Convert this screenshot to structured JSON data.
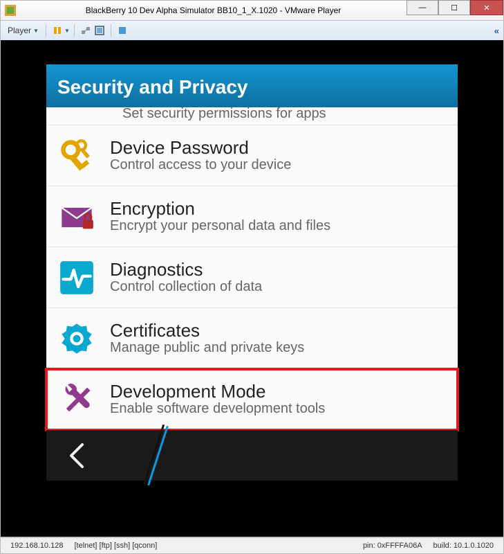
{
  "window": {
    "title": "BlackBerry 10 Dev Alpha Simulator BB10_1_X.1020 - VMware Player",
    "player_label": "Player"
  },
  "bb_header": {
    "title": "Security and Privacy"
  },
  "partial_item_subtitle": "Set security permissions for apps",
  "items": [
    {
      "title": "Device Password",
      "subtitle": "Control access to your device",
      "icon": "key-icon"
    },
    {
      "title": "Encryption",
      "subtitle": "Encrypt your personal data and files",
      "icon": "envelope-lock-icon"
    },
    {
      "title": "Diagnostics",
      "subtitle": "Control collection of data",
      "icon": "pulse-icon"
    },
    {
      "title": "Certificates",
      "subtitle": "Manage public and private keys",
      "icon": "ribbon-icon"
    },
    {
      "title": "Development Mode",
      "subtitle": "Enable software development tools",
      "icon": "tools-icon",
      "highlighted": true
    }
  ],
  "status": {
    "ip": "192.168.10.128",
    "services": "[telnet]  [ftp]  [ssh]  [qconn]",
    "pin": "pin: 0xFFFFA06A",
    "build": "build: 10.1.0.1020"
  }
}
